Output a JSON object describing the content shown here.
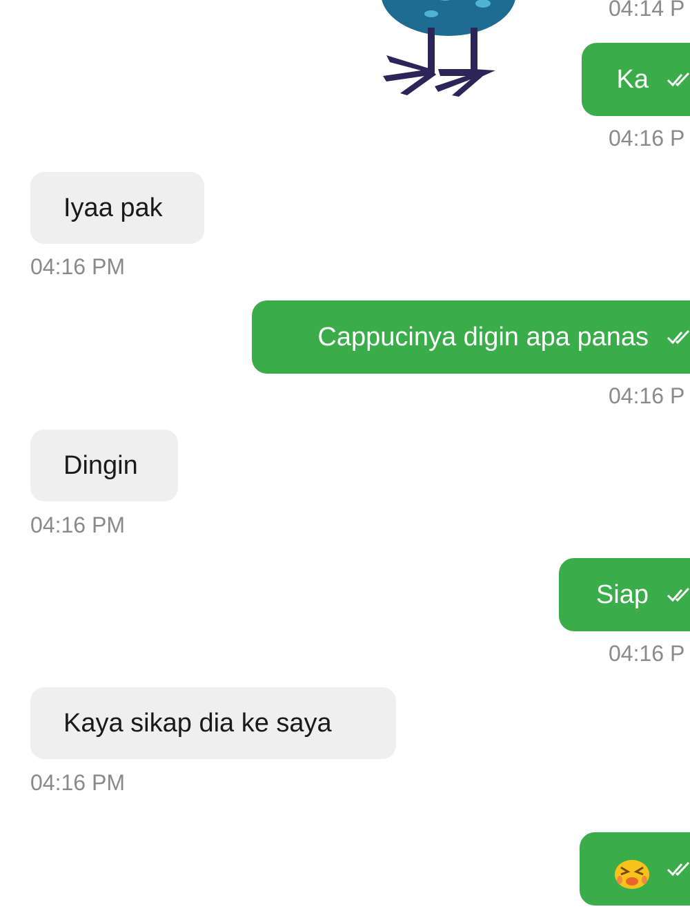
{
  "colors": {
    "outgoing_bubble": "#3bac4a",
    "incoming_bubble": "#efefef",
    "timestamp": "#8a8a8a",
    "sticker_body": "#1e6c92",
    "sticker_legs": "#2d2458"
  },
  "messages": [
    {
      "dir": "out",
      "kind": "sticker",
      "icon": "bird-sticker",
      "time": "04:14 P"
    },
    {
      "dir": "out",
      "text": "Ka",
      "status": "read-double-check-icon",
      "time": "04:16 P"
    },
    {
      "dir": "in",
      "text": "Iyaa pak",
      "time": "04:16 PM"
    },
    {
      "dir": "out",
      "text": "Cappucinya digin apa panas",
      "status": "read-double-check-icon",
      "time": "04:16 P"
    },
    {
      "dir": "in",
      "text": "Dingin",
      "time": "04:16 PM"
    },
    {
      "dir": "out",
      "text": "Siap",
      "status": "read-double-check-icon",
      "time": "04:16 P"
    },
    {
      "dir": "in",
      "text": "Kaya sikap dia ke saya",
      "time": "04:16 PM"
    },
    {
      "dir": "out",
      "kind": "emoji",
      "icon": "crying-face-emoji",
      "status": "read-double-check-icon"
    }
  ]
}
